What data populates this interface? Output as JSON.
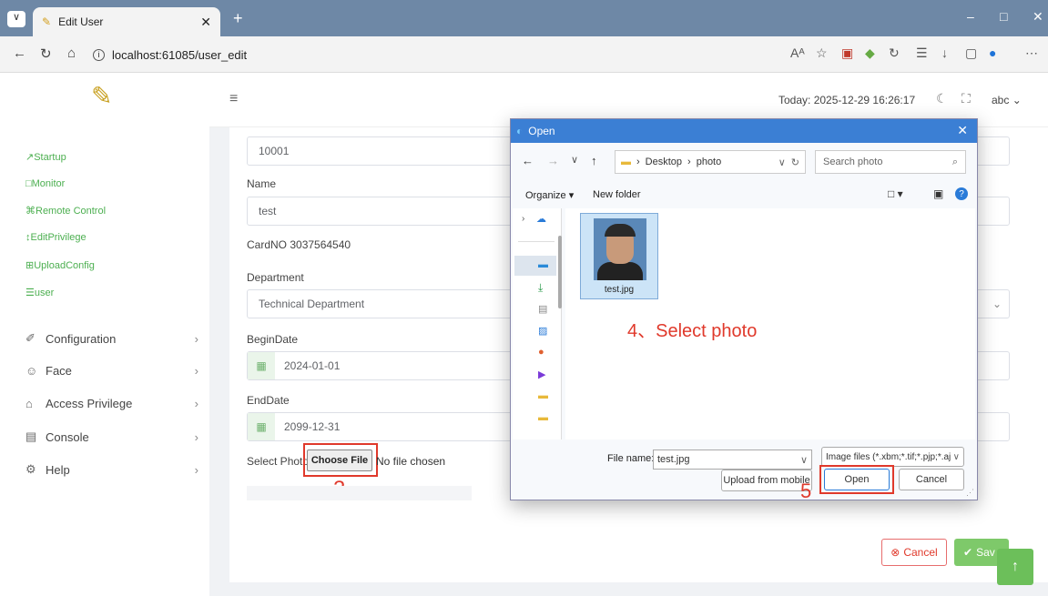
{
  "browser": {
    "tab_title": "Edit User",
    "url": "localhost:61085/user_edit",
    "read_aloud": "Aᴬ"
  },
  "sidebar": {
    "shortcuts": [
      "↗Startup",
      "□Monitor",
      "⌘Remote Control",
      "↕EditPrivilege",
      "⊞UploadConfig",
      "☰user"
    ],
    "menu": [
      {
        "label": "Configuration"
      },
      {
        "label": "Face"
      },
      {
        "label": "Access Privilege"
      },
      {
        "label": "Console"
      },
      {
        "label": "Help"
      }
    ]
  },
  "header": {
    "today": "Today: 2025-12-29 16:26:17",
    "user": "abc"
  },
  "form": {
    "user_id": "10001",
    "name_label": "Name",
    "name_value": "test",
    "card_no": "CardNO 3037564540",
    "department_label": "Department",
    "department_value": "Technical Department",
    "begin_label": "BeginDate",
    "begin_value": "2024-01-01",
    "end_label": "EndDate",
    "end_value": "2099-12-31",
    "photo_label": "Select Photo",
    "choose_file": "Choose File",
    "no_file": "No file chosen",
    "cancel": "Cancel",
    "save": "Sav"
  },
  "dialog": {
    "title": "Open",
    "path_desktop": "Desktop",
    "path_photo": "photo",
    "search_placeholder": "Search photo",
    "organize": "Organize",
    "new_folder": "New folder",
    "file_caption": "test.jpg",
    "file_name_label": "File name:",
    "file_name_value": "test.jpg",
    "file_type": "Image files (*.xbm;*.tif;*.pjp;*.aj",
    "upload_mobile": "Upload from mobile",
    "open": "Open",
    "cancel": "Cancel"
  },
  "annotations": {
    "step3": "3",
    "step4": "4、Select photo",
    "step5": "5"
  }
}
